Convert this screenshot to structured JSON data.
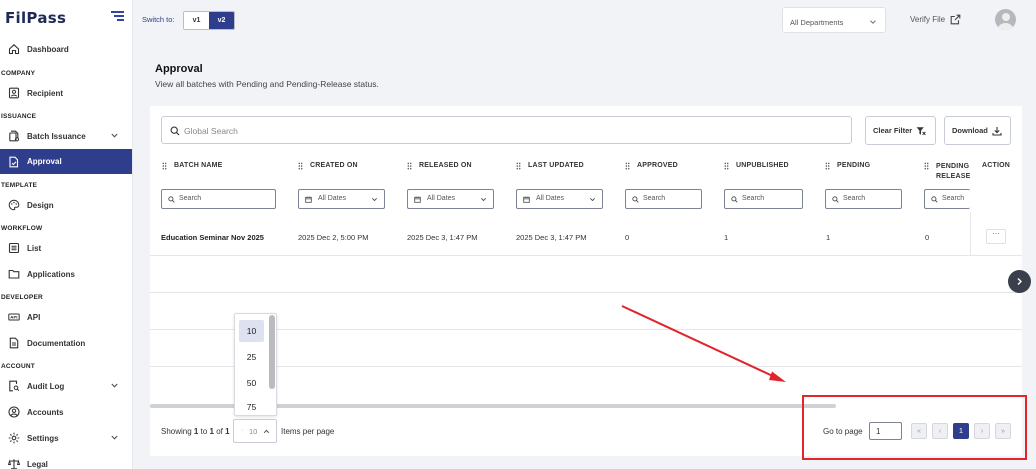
{
  "brand": {
    "logo_text": "FilPass"
  },
  "sidebar": {
    "sections": {
      "company": "COMPANY",
      "issuance": "ISSUANCE",
      "template": "TEMPLATE",
      "workflow": "WORKFLOW",
      "developer": "DEVELOPER",
      "account": "ACCOUNT"
    },
    "items": {
      "dashboard": "Dashboard",
      "recipient": "Recipient",
      "batch_issuance": "Batch Issuance",
      "approval": "Approval",
      "design": "Design",
      "list": "List",
      "applications": "Applications",
      "api": "API",
      "documentation": "Documentation",
      "audit_log": "Audit Log",
      "accounts": "Accounts",
      "settings": "Settings",
      "legal": "Legal"
    },
    "active_item": "Approval"
  },
  "topbar": {
    "switch_label": "Switch to:",
    "versions": [
      "v1",
      "v2"
    ],
    "active_version": "v2",
    "department": "All Departments",
    "verify_label": "Verify File"
  },
  "page": {
    "title": "Approval",
    "subtitle": "View all batches with Pending and Pending-Release status."
  },
  "toolbar": {
    "search_placeholder": "Global Search",
    "clear_filter": "Clear Filter",
    "download": "Download"
  },
  "table": {
    "columns": [
      "BATCH NAME",
      "CREATED ON",
      "RELEASED ON",
      "LAST UPDATED",
      "APPROVED",
      "UNPUBLISHED",
      "PENDING",
      "PENDING RELEASE",
      "ACTION"
    ],
    "filters": {
      "search_placeholder": "Search",
      "date_placeholder": "All Dates"
    },
    "rows": [
      {
        "batch_name": "Education Seminar Nov 2025",
        "created_on": "2025 Dec 2, 5:00 PM",
        "released_on": "2025 Dec 3, 1:47 PM",
        "last_updated": "2025 Dec 3, 1:47 PM",
        "approved": "0",
        "unpublished": "1",
        "pending": "1",
        "pending_release": "0",
        "action": "···"
      }
    ]
  },
  "pagination": {
    "showing_prefix": "Showing",
    "from": "1",
    "to_word": "to",
    "to": "1",
    "of_word": "of",
    "total": "1",
    "items_per_page_label": "Items per page",
    "items_per_page_value": "10",
    "items_per_page_options": [
      "10",
      "25",
      "50",
      "75"
    ],
    "goto_label": "Go to page",
    "goto_value": "1",
    "current_page": "1"
  },
  "colors": {
    "accent": "#2f3e8c",
    "annotation_red": "#e0252b"
  }
}
